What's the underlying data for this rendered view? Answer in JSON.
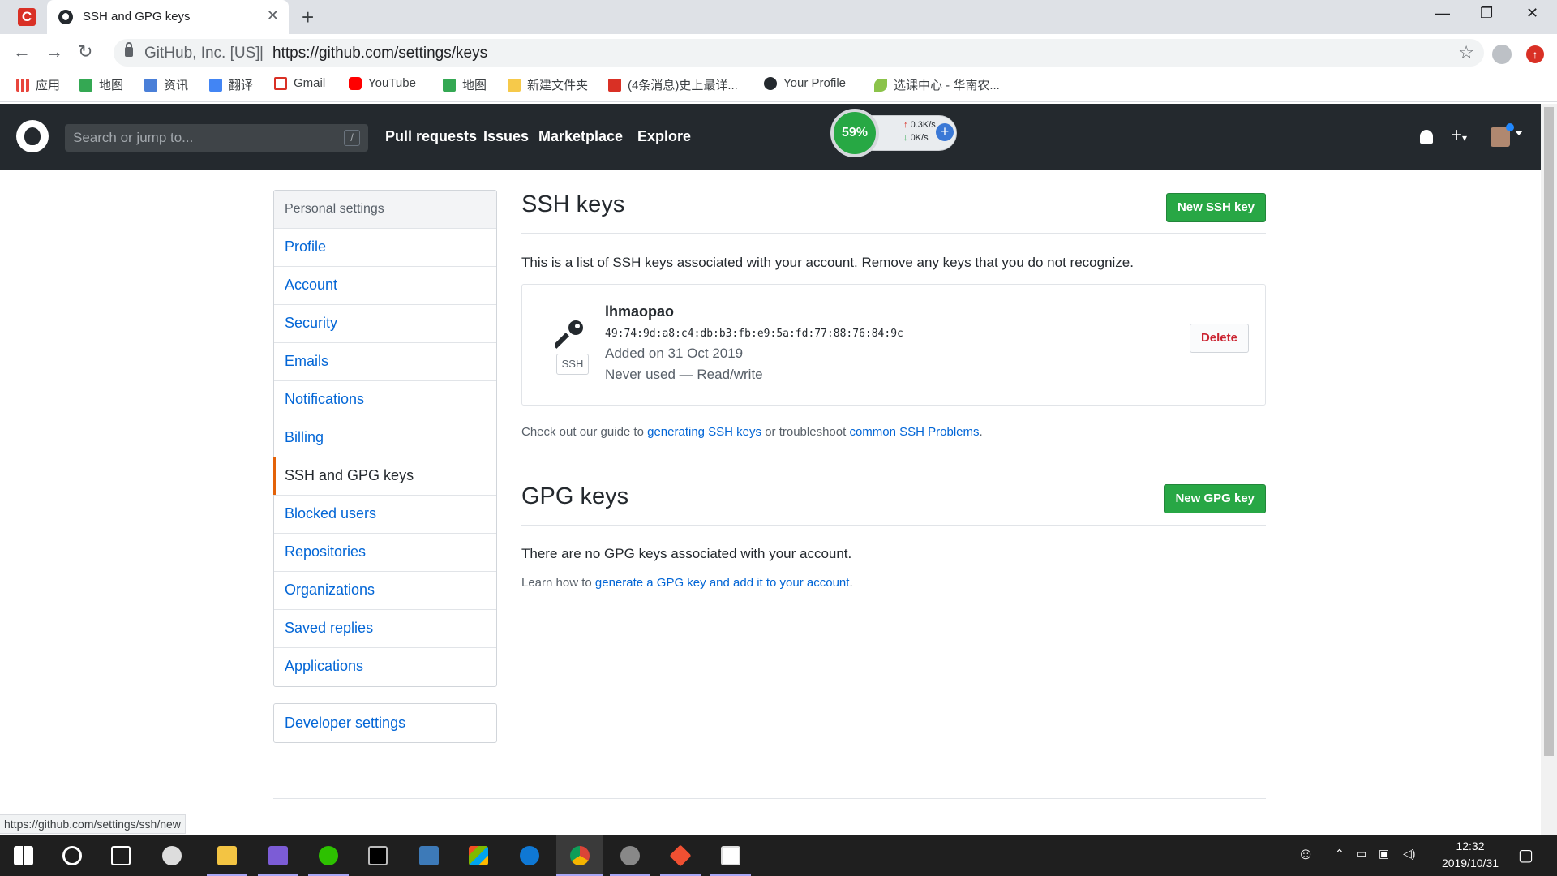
{
  "browser": {
    "tab_title": "SSH and GPG keys",
    "url_org": "GitHub, Inc. [US]",
    "url": "https://github.com/settings/keys",
    "bookmarks": [
      "应用",
      "地图",
      "资讯",
      "翻译",
      "Gmail",
      "YouTube",
      "地图",
      "新建文件夹",
      "(4条消息)史上最详...",
      "Your Profile",
      "选课中心 - 华南农..."
    ]
  },
  "gh_header": {
    "search_placeholder": "Search or jump to...",
    "slash": "/",
    "nav": [
      "Pull requests",
      "Issues",
      "Marketplace",
      "Explore"
    ]
  },
  "net_widget": {
    "percent": "59%",
    "up": "0.3K/s",
    "down": "0K/s"
  },
  "sidebar": {
    "heading": "Personal settings",
    "items": [
      "Profile",
      "Account",
      "Security",
      "Emails",
      "Notifications",
      "Billing",
      "SSH and GPG keys",
      "Blocked users",
      "Repositories",
      "Organizations",
      "Saved replies",
      "Applications"
    ],
    "selected": "SSH and GPG keys",
    "developer": "Developer settings"
  },
  "ssh": {
    "title": "SSH keys",
    "new_button": "New SSH key",
    "description": "This is a list of SSH keys associated with your account. Remove any keys that you do not recognize.",
    "key": {
      "name": "lhmaopao",
      "fingerprint": "49:74:9d:a8:c4:db:b3:fb:e9:5a:fd:77:88:76:84:9c",
      "added": "Added on 31 Oct 2019",
      "usage": "Never used — Read/write",
      "badge": "SSH",
      "delete_label": "Delete"
    },
    "guide_prefix": "Check out our guide to ",
    "guide_link1": "generating SSH keys",
    "guide_mid": " or troubleshoot ",
    "guide_link2": "common SSH Problems",
    "guide_suffix": "."
  },
  "gpg": {
    "title": "GPG keys",
    "new_button": "New GPG key",
    "empty": "There are no GPG keys associated with your account.",
    "learn_prefix": "Learn how to ",
    "learn_link": "generate a GPG key and add it to your account",
    "learn_suffix": "."
  },
  "status_url": "https://github.com/settings/ssh/new",
  "taskbar": {
    "time": "12:32",
    "date": "2019/10/31"
  }
}
